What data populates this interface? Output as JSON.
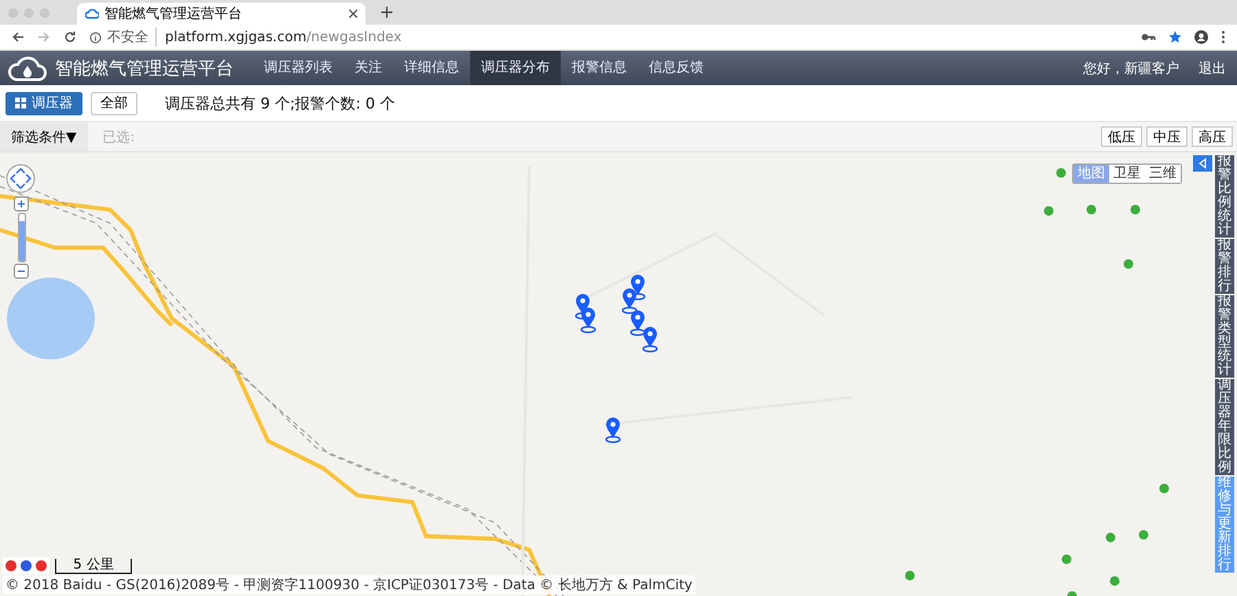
{
  "browser": {
    "tab_title": "智能燃气管理运营平台",
    "new_tab": "+",
    "security": "不安全",
    "url_host": "platform.xgjgas.com",
    "url_path": "/newgasIndex"
  },
  "nav": {
    "title": "智能燃气管理运营平台",
    "items": [
      {
        "label": "调压器列表",
        "selected": false
      },
      {
        "label": "关注",
        "selected": false
      },
      {
        "label": "详细信息",
        "selected": false
      },
      {
        "label": "调压器分布",
        "selected": true
      },
      {
        "label": "报警信息",
        "selected": false
      },
      {
        "label": "信息反馈",
        "selected": false
      }
    ],
    "greeting": "您好，新疆客户",
    "logout": "退出"
  },
  "toolbar": {
    "buttons": [
      {
        "label": "调压器",
        "selected": true
      },
      {
        "label": "全部",
        "selected": false
      }
    ],
    "summary": "调压器总共有 9 个;报警个数: 0 个"
  },
  "filter": {
    "button": "筛选条件▼",
    "selected_label": "已选:",
    "pressure_buttons": [
      "低压",
      "中压",
      "高压"
    ]
  },
  "map": {
    "type_switch": [
      {
        "label": "地图",
        "selected": true
      },
      {
        "label": "卫星",
        "selected": false
      },
      {
        "label": "三维",
        "selected": false
      }
    ],
    "side_tabs": [
      {
        "label": "报警比例统计",
        "selected": false
      },
      {
        "label": "报警排行",
        "selected": false
      },
      {
        "label": "报警类型统计",
        "selected": false
      },
      {
        "label": "调压器年限比例",
        "selected": false
      },
      {
        "label": "维修与更新排行",
        "selected": true
      }
    ],
    "zoom": {
      "level": 0.85
    },
    "scale": "5 公里",
    "attribution": "© 2018 Baidu - GS(2016)2089号 - 甲测资字1100930 - 京ICP证030173号 - Data © 长地万方 & PalmCity"
  }
}
